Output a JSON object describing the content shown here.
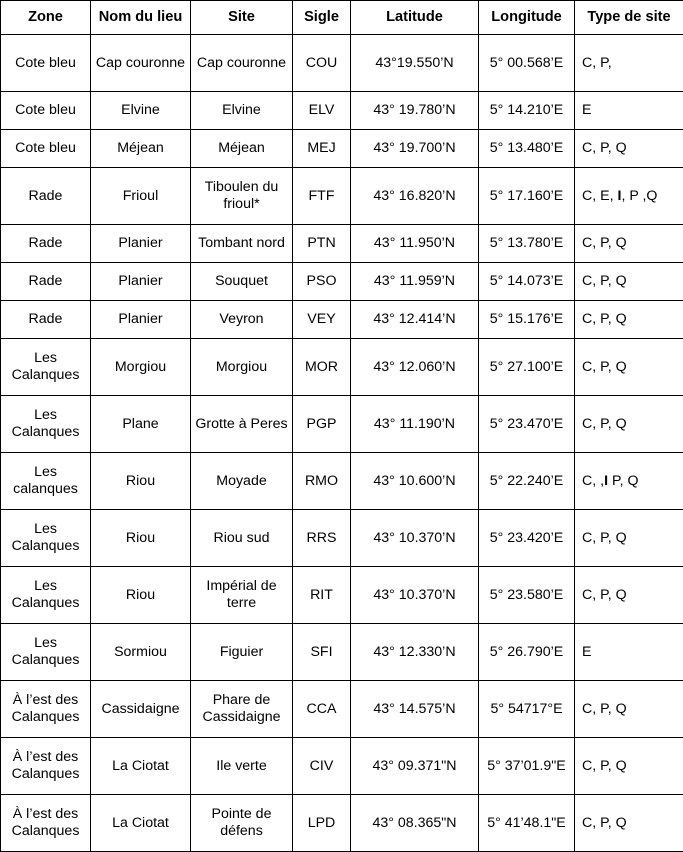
{
  "table": {
    "columns": [
      {
        "key": "zone",
        "label": "Zone"
      },
      {
        "key": "nom",
        "label": "Nom du lieu"
      },
      {
        "key": "site",
        "label": "Site"
      },
      {
        "key": "sigle",
        "label": "Sigle"
      },
      {
        "key": "latitude",
        "label": "Latitude"
      },
      {
        "key": "longitude",
        "label": "Longitude"
      },
      {
        "key": "type",
        "label": "Type de site"
      }
    ],
    "rows": [
      {
        "zone": "Cote bleu",
        "nom": "Cap couronne",
        "site": "Cap couronne",
        "sigle": "COU",
        "latitude": "43°19.550’N",
        "longitude": "5° 00.568’E",
        "type": "C, P,",
        "height": "tall"
      },
      {
        "zone": "Cote bleu",
        "nom": "Elvine",
        "site": "Elvine",
        "sigle": "ELV",
        "latitude": "43° 19.780’N",
        "longitude": "5° 14.210’E",
        "type": "E",
        "height": "short"
      },
      {
        "zone": "Cote bleu",
        "nom": "Méjean",
        "site": "Méjean",
        "sigle": "MEJ",
        "latitude": "43° 19.700’N",
        "longitude": "5° 13.480’E",
        "type": "C, P, Q",
        "height": "short"
      },
      {
        "zone": "Rade",
        "nom": "Frioul",
        "site": "Tiboulen du frioul*",
        "sigle": "FTF",
        "latitude": "43° 16.820’N",
        "longitude": "5° 17.160’E",
        "type_html": "C, E, <span class=\"bold-i\">I</span>, P ,Q",
        "type": "C, E, I, P ,Q",
        "height": "tall"
      },
      {
        "zone": "Rade",
        "nom": "Planier",
        "site": "Tombant nord",
        "sigle": "PTN",
        "latitude": "43° 11.950’N",
        "longitude": "5° 13.780’E",
        "type": "C, P, Q",
        "height": "short"
      },
      {
        "zone": "Rade",
        "nom": "Planier",
        "site": "Souquet",
        "sigle": "PSO",
        "latitude": "43° 11.959’N",
        "longitude": "5° 14.073’E",
        "type": "C, P, Q",
        "height": "short"
      },
      {
        "zone": "Rade",
        "nom": "Planier",
        "site": "Veyron",
        "sigle": "VEY",
        "latitude": "43° 12.414’N",
        "longitude": "5° 15.176’E",
        "type": "C, P, Q",
        "height": "short"
      },
      {
        "zone": "Les Calanques",
        "nom": "Morgiou",
        "site": "Morgiou",
        "sigle": "MOR",
        "latitude": "43° 12.060’N",
        "longitude": "5° 27.100’E",
        "type": "C, P, Q",
        "height": "tall"
      },
      {
        "zone": "Les Calanques",
        "nom": "Plane",
        "site": "Grotte à Peres",
        "sigle": "PGP",
        "latitude": "43° 11.190’N",
        "longitude": "5° 23.470’E",
        "type": "C, P, Q",
        "height": "tall"
      },
      {
        "zone": "Les calanques",
        "nom": "Riou",
        "site": "Moyade",
        "sigle": "RMO",
        "latitude": "43° 10.600’N",
        "longitude": "5° 22.240’E",
        "type_html": "C, ,<span class=\"bold-i\">I</span> P, Q",
        "type": "C, ,I P, Q",
        "height": "tall"
      },
      {
        "zone": "Les Calanques",
        "nom": "Riou",
        "site": "Riou sud",
        "sigle": "RRS",
        "latitude": "43° 10.370’N",
        "longitude": "5° 23.420’E",
        "type": "C, P, Q",
        "height": "tall"
      },
      {
        "zone": "Les Calanques",
        "nom": "Riou",
        "site": "Impérial de terre",
        "sigle": "RIT",
        "latitude": "43° 10.370’N",
        "longitude": "5° 23.580’E",
        "type": "C, P, Q",
        "height": "tall"
      },
      {
        "zone": "Les Calanques",
        "nom": "Sormiou",
        "site": "Figuier",
        "sigle": "SFI",
        "latitude": "43° 12.330’N",
        "longitude": "5° 26.790’E",
        "type": "E",
        "height": "tall"
      },
      {
        "zone": "À l’est des Calanques",
        "nom": "Cassidaigne",
        "site": "Phare de Cassidaigne",
        "sigle": "CCA",
        "latitude": "43° 14.575’N",
        "longitude": "5° 54717°E",
        "type": "C, P, Q",
        "height": "tall"
      },
      {
        "zone": "À l’est des Calanques",
        "nom": "La Ciotat",
        "site": "Ile verte",
        "sigle": "CIV",
        "latitude": "43° 09.371\"N",
        "longitude": "5° 37’01.9\"E",
        "type": "C, P, Q",
        "height": "tall"
      },
      {
        "zone": "À l’est des Calanques",
        "nom": "La Ciotat",
        "site": "Pointe de défens",
        "sigle": "LPD",
        "latitude": "43° 08.365\"N",
        "longitude": "5° 41’48.1\"E",
        "type": "C, P, Q",
        "height": "tall"
      }
    ]
  }
}
